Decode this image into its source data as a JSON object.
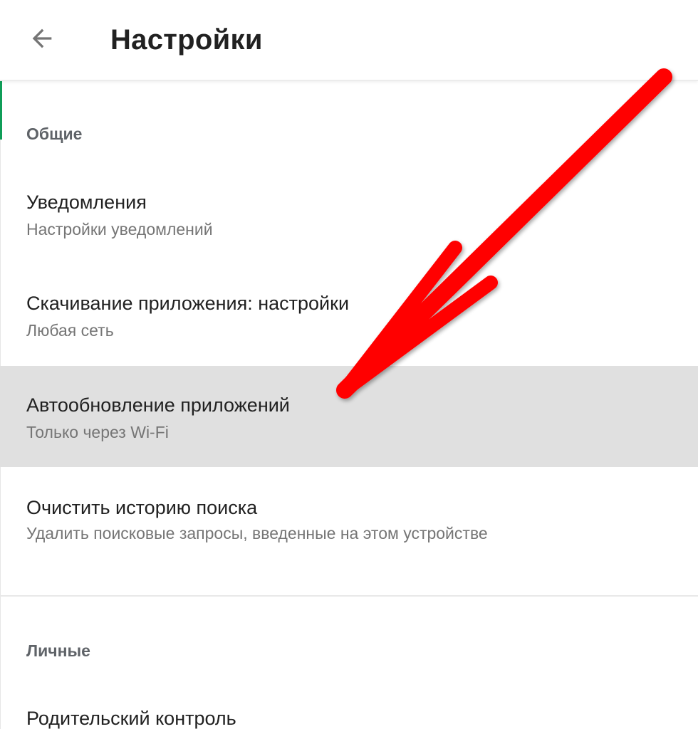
{
  "header": {
    "title": "Настройки",
    "back_icon": "arrow-back-icon"
  },
  "sections": [
    {
      "header": "Общие",
      "items": [
        {
          "title": "Уведомления",
          "subtitle": "Настройки уведомлений"
        },
        {
          "title": "Скачивание приложения: настройки",
          "subtitle": "Любая сеть"
        },
        {
          "title": "Автообновление приложений",
          "subtitle": "Только через Wi-Fi",
          "highlighted": true
        },
        {
          "title": "Очистить историю поиска",
          "subtitle": "Удалить поисковые запросы, введенные на этом устройстве"
        }
      ]
    },
    {
      "header": "Личные",
      "items": [
        {
          "title": "Родительский контроль"
        }
      ]
    }
  ],
  "colors": {
    "accent": "#0f9d58",
    "highlight_bg": "#e0e0e0",
    "arrow": "#ff0000",
    "title_text": "#212121",
    "subtitle_text": "#757575"
  }
}
